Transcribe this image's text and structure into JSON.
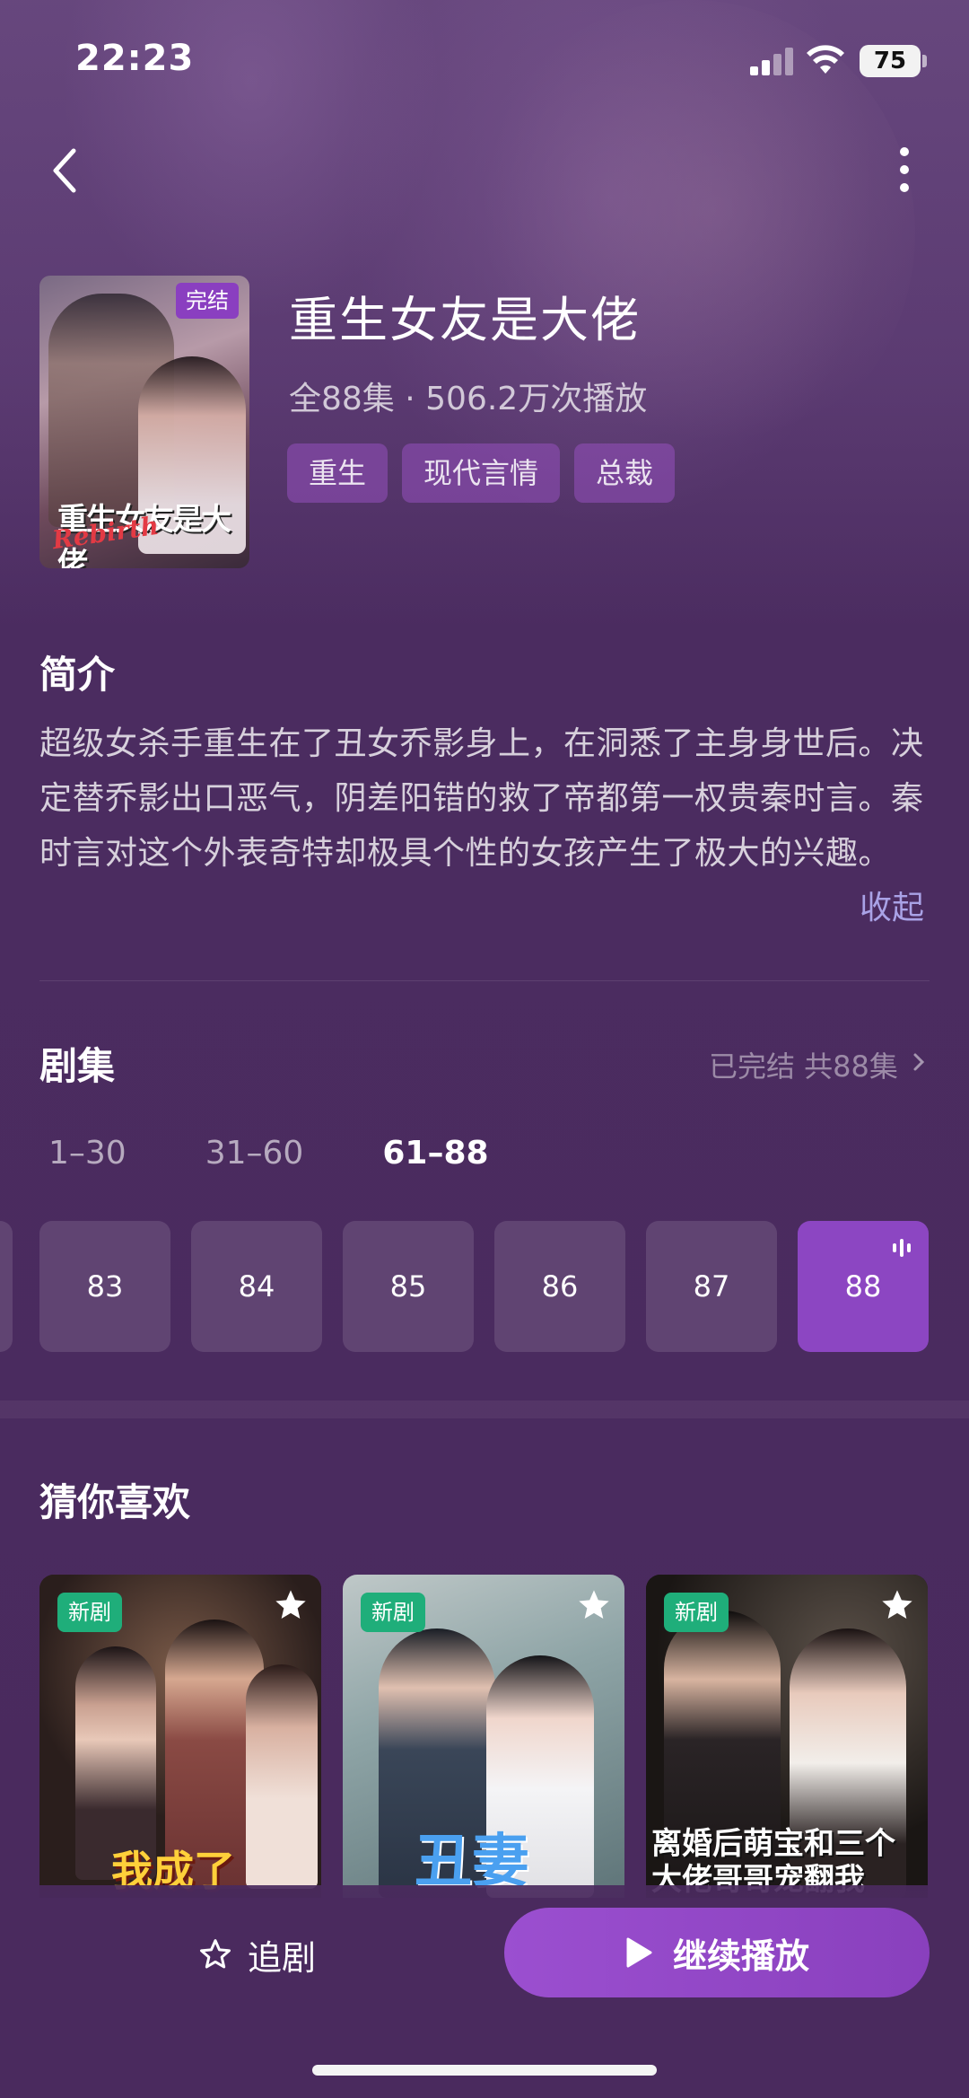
{
  "status_bar": {
    "time": "22:23",
    "battery": "75"
  },
  "drama": {
    "title": "重生女友是大佬",
    "meta": "全88集 · 506.2万次播放",
    "poster_badge": "完结",
    "poster_title": "重生女友是大佬",
    "poster_subtitle": "Rebirth",
    "tags": [
      "重生",
      "现代言情",
      "总裁"
    ]
  },
  "intro": {
    "heading": "简介",
    "text": "超级女杀手重生在了丑女乔影身上，在洞悉了主身身世后。决定替乔影出口恶气，阴差阳错的救了帝都第一权贵秦时言。秦时言对这个外表奇特却极具个性的女孩产生了极大的兴趣。",
    "collapse_label": "收起"
  },
  "episodes": {
    "heading": "剧集",
    "status": "已完结 共88集",
    "ranges": [
      "1–30",
      "31–60",
      "61–88"
    ],
    "active_range": "61–88",
    "items": [
      "83",
      "84",
      "85",
      "86",
      "87",
      "88"
    ],
    "current": "88"
  },
  "recommend": {
    "heading": "猜你喜欢",
    "cards": [
      {
        "badge": "新剧",
        "caption": "我成了"
      },
      {
        "badge": "新剧",
        "caption": "丑妻"
      },
      {
        "badge": "新剧",
        "caption": "离婚后萌宝和三个大佬哥哥宠翻我"
      }
    ]
  },
  "bottom": {
    "follow_label": "追剧",
    "play_label": "继续播放"
  },
  "colors": {
    "accent": "#8c46c2",
    "new_badge": "#1fae7a",
    "link": "#a9a2e6"
  }
}
